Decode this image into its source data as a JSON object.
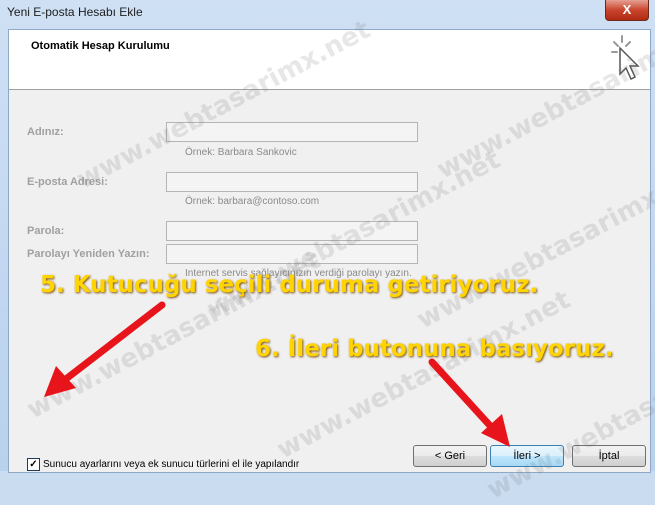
{
  "window": {
    "title": "Yeni E-posta Hesabı Ekle",
    "close_glyph": "X"
  },
  "header": {
    "title": "Otomatik Hesap Kurulumu"
  },
  "form": {
    "name_label": "Adınız:",
    "name_hint": "Örnek: Barbara Sankovic",
    "email_label": "E-posta Adresi:",
    "email_hint": "Örnek: barbara@contoso.com",
    "password_label": "Parola:",
    "password_retype_label": "Parolayı Yeniden Yazın:",
    "password_hint": "Internet servis sağlayıcınızın verdiği parolayı yazın."
  },
  "manual_setup": {
    "label": "Sunucu ayarlarını veya ek sunucu türlerini el ile yapılandır",
    "checked": true
  },
  "buttons": {
    "back": "< Geri",
    "next": "İleri >",
    "cancel": "İptal"
  },
  "annotations": {
    "step5": "5. Kutucuğu seçili duruma getiriyoruz.",
    "step6": "6. İleri butonuna basıyoruz.",
    "color": "#ffd400",
    "arrow_color": "#e8141b"
  },
  "watermark": "www.webtasarimx.net"
}
